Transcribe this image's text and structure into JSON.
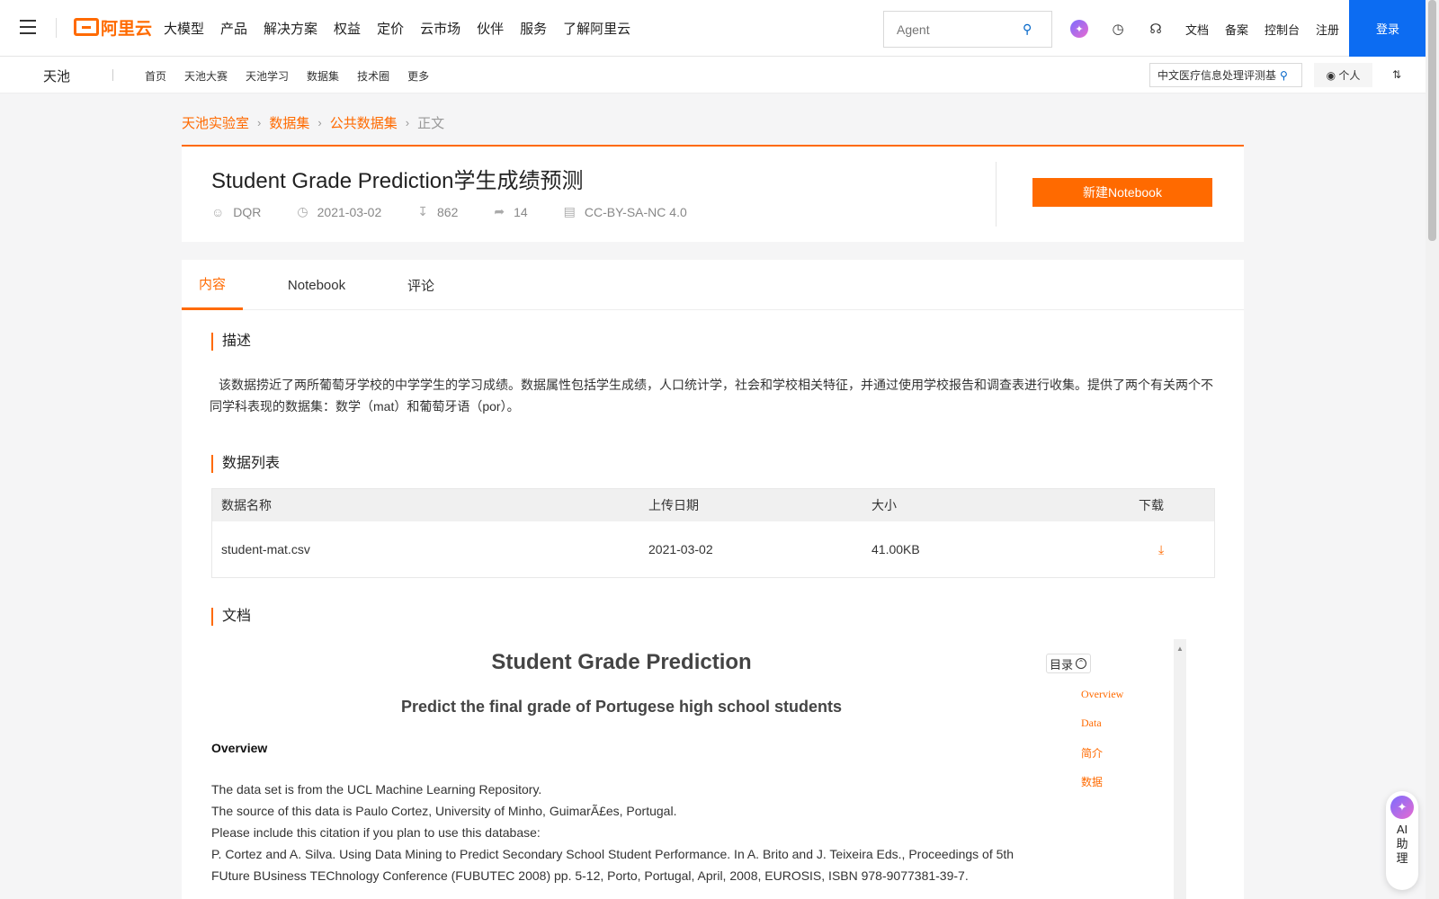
{
  "topnav": {
    "logo": "阿里云",
    "menu": [
      "大模型",
      "产品",
      "解决方案",
      "权益",
      "定价",
      "云市场",
      "伙伴",
      "服务",
      "了解阿里云"
    ],
    "search_placeholder": "Agent",
    "links": [
      "文档",
      "备案",
      "控制台",
      "注册"
    ],
    "login": "登录"
  },
  "subnav": {
    "brand": "天池",
    "links": [
      "首页",
      "天池大赛",
      "天池学习",
      "数据集",
      "技术圈",
      "更多"
    ],
    "search_value": "中文医疗信息处理评测基",
    "personal": "个人"
  },
  "breadcrumb": [
    "天池实验室",
    "数据集",
    "公共数据集",
    "正文"
  ],
  "dataset": {
    "title": "Student Grade Prediction学生成绩预测",
    "author": "DQR",
    "date": "2021-03-02",
    "downloads": "862",
    "shares": "14",
    "license": "CC-BY-SA-NC 4.0",
    "new_notebook": "新建Notebook"
  },
  "tabs": [
    "内容",
    "Notebook",
    "评论"
  ],
  "sections": {
    "desc_title": "描述",
    "desc_text": "该数据捞近了两所葡萄牙学校的中学学生的学习成绩。数据属性包括学生成绩，人口统计学，社会和学校相关特征，并通过使用学校报告和调查表进行收集。提供了两个有关两个不同学科表现的数据集：数学（mat）和葡萄牙语（por）。",
    "list_title": "数据列表",
    "doc_title": "文档"
  },
  "table": {
    "headers": [
      "数据名称",
      "上传日期",
      "大小",
      "下载"
    ],
    "rows": [
      {
        "name": "student-mat.csv",
        "date": "2021-03-02",
        "size": "41.00KB"
      }
    ]
  },
  "document": {
    "title": "Student Grade Prediction",
    "subtitle": "Predict the final grade of Portugese high school students",
    "heading": "Overview",
    "lines": [
      "The data set is from the UCL Machine Learning Repository.",
      "The source of this data is Paulo Cortez, University of Minho, GuimarÃ£es, Portugal.",
      "Please include this citation if you plan to use this database:",
      "P. Cortez and A. Silva. Using Data Mining to Predict Secondary School Student Performance. In A. Brito and J. Teixeira Eds., Proceedings of 5th",
      "FUture BUsiness TEChnology Conference (FUBUTEC 2008) pp. 5-12, Porto, Portugal, April, 2008, EUROSIS, ISBN 978-9077381-39-7."
    ],
    "toc_label": "目录",
    "toc": [
      "Overview",
      "Data",
      "简介",
      "数据"
    ]
  },
  "ai_assistant": "AI助理",
  "colors": {
    "accent": "#ff6a00",
    "login": "#0c6cf2"
  }
}
